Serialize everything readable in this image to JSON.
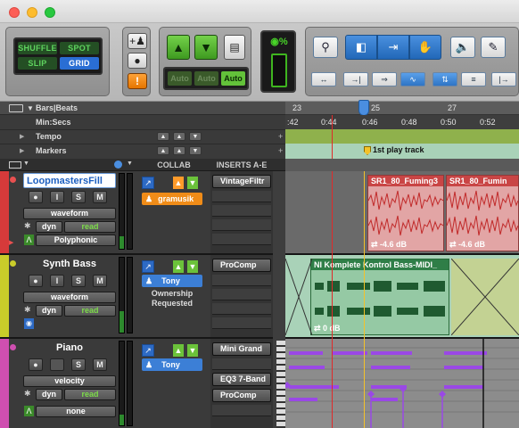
{
  "toolbar": {
    "edit_modes": {
      "shuffle": "SHUFFLE",
      "spot": "SPOT",
      "slip": "SLIP",
      "grid": "GRID"
    },
    "automation_buttons": [
      "Auto",
      "Auto",
      "Auto"
    ],
    "icons": [
      "add-person-icon",
      "speech-bubble-icon",
      "info-icon",
      "arrow-up-icon",
      "arrow-down-icon",
      "document-icon",
      "eye-percent-icon",
      "zoom-icon",
      "trim-tool-icon",
      "selector-tool-icon",
      "grabber-tool-icon",
      "speaker-icon",
      "pencil-icon"
    ]
  },
  "rulers": {
    "bars_label": "Bars|Beats",
    "minsecs_label": "Min:Secs",
    "tempo_label": "Tempo",
    "markers_label": "Markers",
    "bars_ticks": [
      "23",
      "25",
      "27"
    ],
    "minsecs_ticks": [
      ":42",
      "0:44",
      "0:46",
      "0:48",
      "0:50",
      "0:52"
    ],
    "marker_text": "1st play track"
  },
  "columns": {
    "collab": "COLLAB",
    "inserts": "INSERTS A-E"
  },
  "tracks": [
    {
      "name": "LoopmastersFill",
      "color": "#d63a3a",
      "view": "waveform",
      "dyn": "dyn",
      "automation": "read",
      "mode": "Polyphonic",
      "collab_user": "gramusik",
      "inserts": [
        "VintageFiltr"
      ],
      "clips": [
        {
          "name": "SR1_80_Fuming3",
          "gain": "-4.6 dB"
        },
        {
          "name": "SR1_80_Fumin",
          "gain": "-4.6 dB"
        }
      ]
    },
    {
      "name": "Synth Bass",
      "color": "#c9cc2a",
      "view": "waveform",
      "dyn": "dyn",
      "automation": "read",
      "collab_user": "Tony",
      "collab_status": "Ownership Requested",
      "inserts": [
        "ProComp"
      ],
      "clips": [
        {
          "name": "NI Komplete Kontrol Bass-MIDI_",
          "gain": "0 dB"
        }
      ]
    },
    {
      "name": "Piano",
      "color": "#cf4fb0",
      "view": "velocity",
      "dyn": "dyn",
      "automation": "read",
      "mode": "none",
      "collab_user": "Tony",
      "inserts": [
        "Mini Grand",
        "EQ3 7-Band",
        "ProComp"
      ]
    }
  ],
  "track_buttons": {
    "record": "●",
    "input": "I",
    "solo": "S",
    "mute": "M"
  }
}
